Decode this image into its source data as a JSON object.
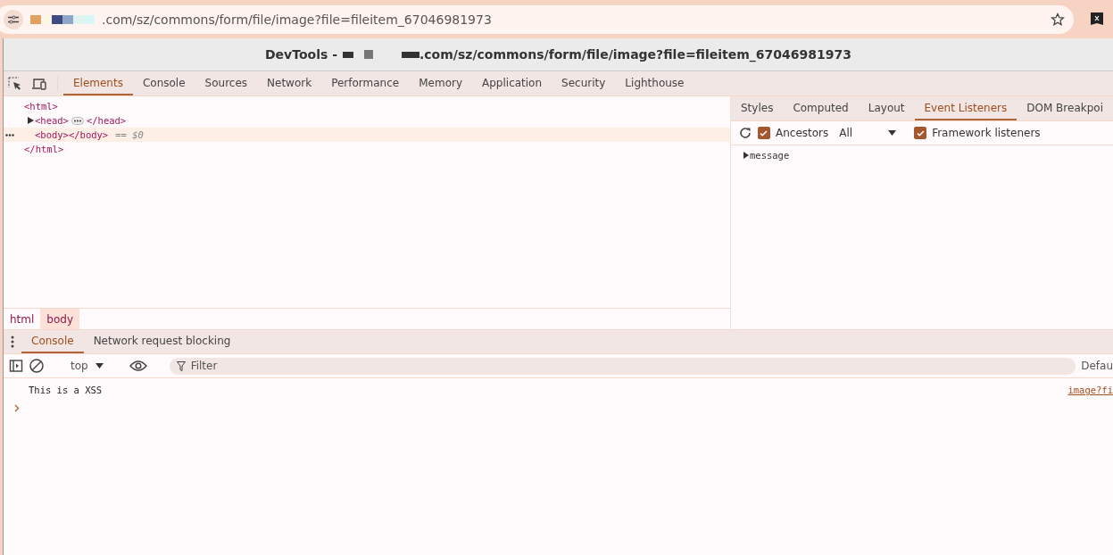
{
  "browser": {
    "address": ".com/sz/commons/form/file/image?file=fileitem_67046981973"
  },
  "window": {
    "title_prefix": "DevTools -",
    "title_url": ".com/sz/commons/form/file/image?file=fileitem_67046981973"
  },
  "tabs": [
    {
      "label": "Elements",
      "selected": true
    },
    {
      "label": "Console",
      "selected": false
    },
    {
      "label": "Sources",
      "selected": false
    },
    {
      "label": "Network",
      "selected": false
    },
    {
      "label": "Performance",
      "selected": false
    },
    {
      "label": "Memory",
      "selected": false
    },
    {
      "label": "Application",
      "selected": false
    },
    {
      "label": "Security",
      "selected": false
    },
    {
      "label": "Lighthouse",
      "selected": false
    }
  ],
  "dom_tree": [
    {
      "open": "<html>",
      "close": "</html>",
      "selected": false,
      "children": [
        {
          "open": "<head>",
          "close": "</head>",
          "expanded": false,
          "selected": false
        },
        {
          "open": "<body>",
          "close": "</body>",
          "selected": true,
          "suffix": "== $0"
        }
      ]
    }
  ],
  "breadcrumbs": [
    {
      "label": "html",
      "selected": false
    },
    {
      "label": "body",
      "selected": true
    }
  ],
  "sidebar": {
    "tabs": [
      {
        "label": "Styles",
        "selected": false
      },
      {
        "label": "Computed",
        "selected": false
      },
      {
        "label": "Layout",
        "selected": false
      },
      {
        "label": "Event Listeners",
        "selected": true
      },
      {
        "label": "DOM Breakpoi",
        "selected": false
      }
    ],
    "ancestors": {
      "label": "Ancestors",
      "checked": true
    },
    "filter_select": "All",
    "framework": {
      "label": "Framework listeners",
      "checked": true
    },
    "listeners": [
      {
        "label": "message",
        "expanded": false
      }
    ]
  },
  "drawer": {
    "tabs": [
      {
        "label": "Console",
        "selected": true
      },
      {
        "label": "Network request blocking",
        "selected": false
      }
    ],
    "context": "top",
    "filter_placeholder": "Filter",
    "levels": "Defau",
    "messages": [
      {
        "text": "This is a XSS",
        "source": "image?fi"
      }
    ]
  }
}
